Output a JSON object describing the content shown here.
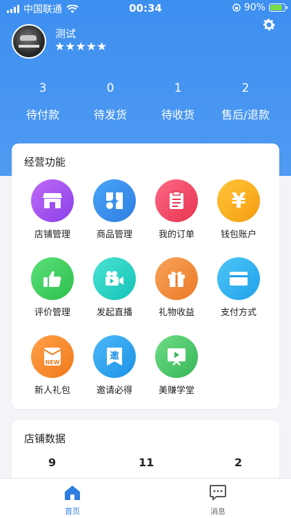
{
  "status_bar": {
    "carrier": "中国联通",
    "time": "00:34",
    "battery": "90%",
    "battery_level": 0.9
  },
  "profile": {
    "name": "测试",
    "stars": "★★★★★",
    "rating": 5
  },
  "stats": [
    {
      "value": "3",
      "label": "待付款"
    },
    {
      "value": "0",
      "label": "待发货"
    },
    {
      "value": "1",
      "label": "待收货"
    },
    {
      "value": "2",
      "label": "售后/退款"
    }
  ],
  "functions": {
    "title": "经营功能",
    "items": [
      {
        "label": "店铺管理",
        "icon": "store-icon",
        "color": "#9b4ff0"
      },
      {
        "label": "商品管理",
        "icon": "product-icon",
        "color": "#3d8ff0"
      },
      {
        "label": "我的订单",
        "icon": "order-icon",
        "color": "#f0456b"
      },
      {
        "label": "钱包账户",
        "icon": "wallet-icon",
        "color": "#f7a81b"
      },
      {
        "label": "评价管理",
        "icon": "thumb-up-icon",
        "color": "#3ccf5c"
      },
      {
        "label": "发起直播",
        "icon": "live-camera-icon",
        "color": "#23cfc4"
      },
      {
        "label": "礼物收益",
        "icon": "gift-icon",
        "color": "#f08a3a"
      },
      {
        "label": "支付方式",
        "icon": "card-icon",
        "color": "#2fb0f0"
      },
      {
        "label": "新人礼包",
        "icon": "new-gift-pack-icon",
        "color": "#f58a2c"
      },
      {
        "label": "邀请必得",
        "icon": "invite-icon",
        "color": "#2ea8f0"
      },
      {
        "label": "美赚学堂",
        "icon": "video-class-icon",
        "color": "#4cc96a"
      }
    ]
  },
  "shop_data": {
    "title": "店铺数据",
    "values": [
      "9",
      "11",
      "2"
    ]
  },
  "tabbar": {
    "home_label": "首页",
    "messages_label": "消息",
    "active_color": "#2f7de1"
  },
  "icon_texts": {
    "invite": "邀",
    "new": "NEW",
    "yen": "¥"
  }
}
